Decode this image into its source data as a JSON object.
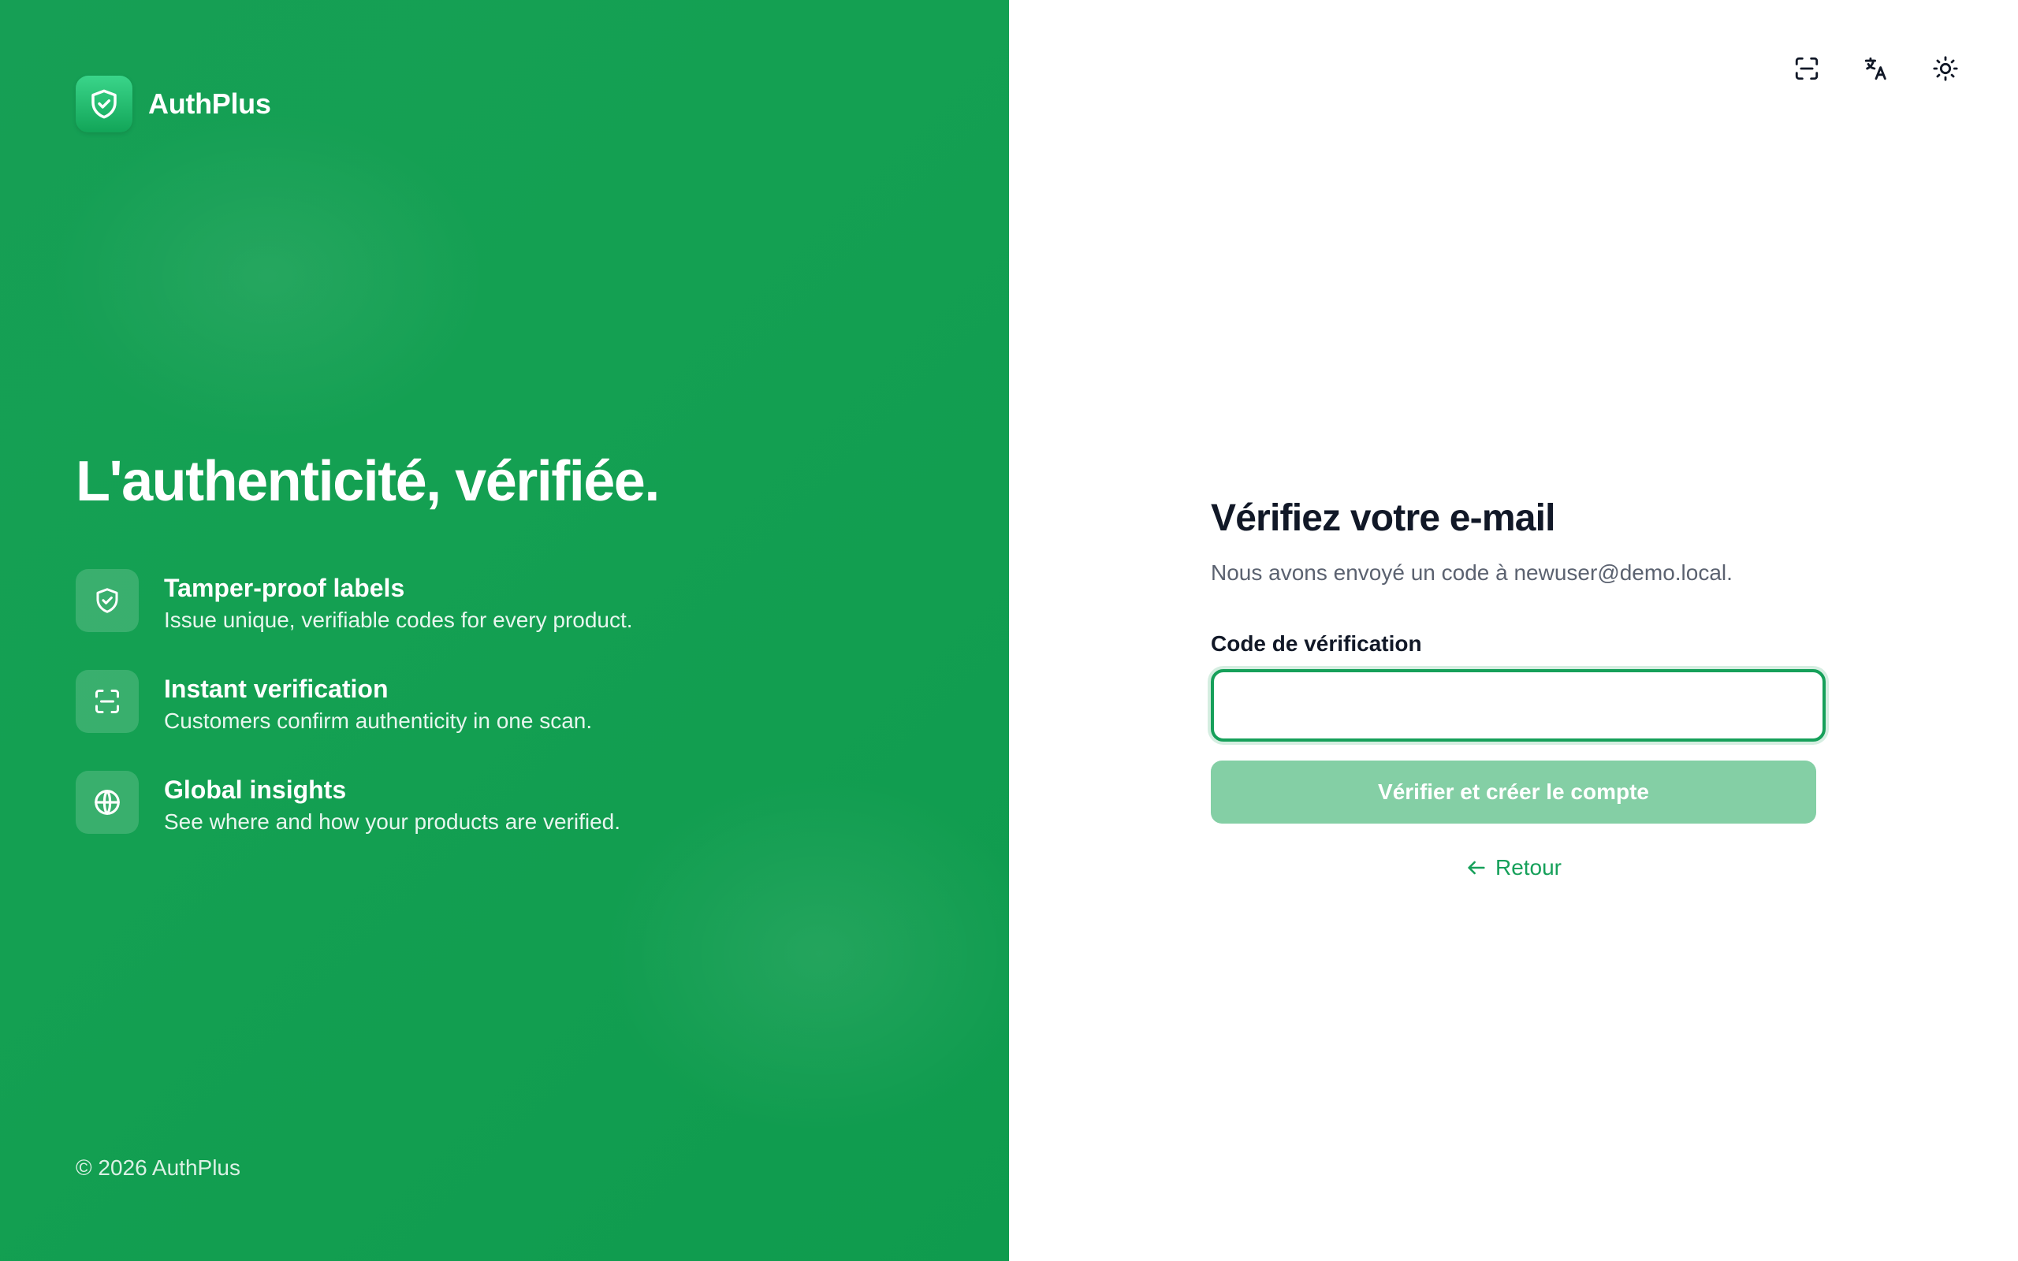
{
  "brand": {
    "name": "AuthPlus",
    "logo_icon": "shield-check-icon"
  },
  "hero": {
    "title": "L'authenticité, vérifiée."
  },
  "features": [
    {
      "icon": "shield-check-icon",
      "title": "Tamper-proof labels",
      "description": "Issue unique, verifiable codes for every product."
    },
    {
      "icon": "scan-icon",
      "title": "Instant verification",
      "description": "Customers confirm authenticity in one scan."
    },
    {
      "icon": "globe-icon",
      "title": "Global insights",
      "description": "See where and how your products are verified."
    }
  ],
  "footer": {
    "copyright": "© 2026 AuthPlus"
  },
  "toolbar": {
    "icons": [
      "scan-icon",
      "translate-icon",
      "sun-icon"
    ]
  },
  "form": {
    "title": "Vérifiez votre e-mail",
    "subtitle": "Nous avons envoyé un code à newuser@demo.local.",
    "code_label": "Code de vérification",
    "code_value": "",
    "submit_label": "Vérifier et créer le compte",
    "back_label": "Retour"
  },
  "colors": {
    "brand_green": "#14a052",
    "accent": "#16a05a",
    "button_disabled": "#84cfa5",
    "title_text": "#111827",
    "muted_text": "#5b6270"
  }
}
